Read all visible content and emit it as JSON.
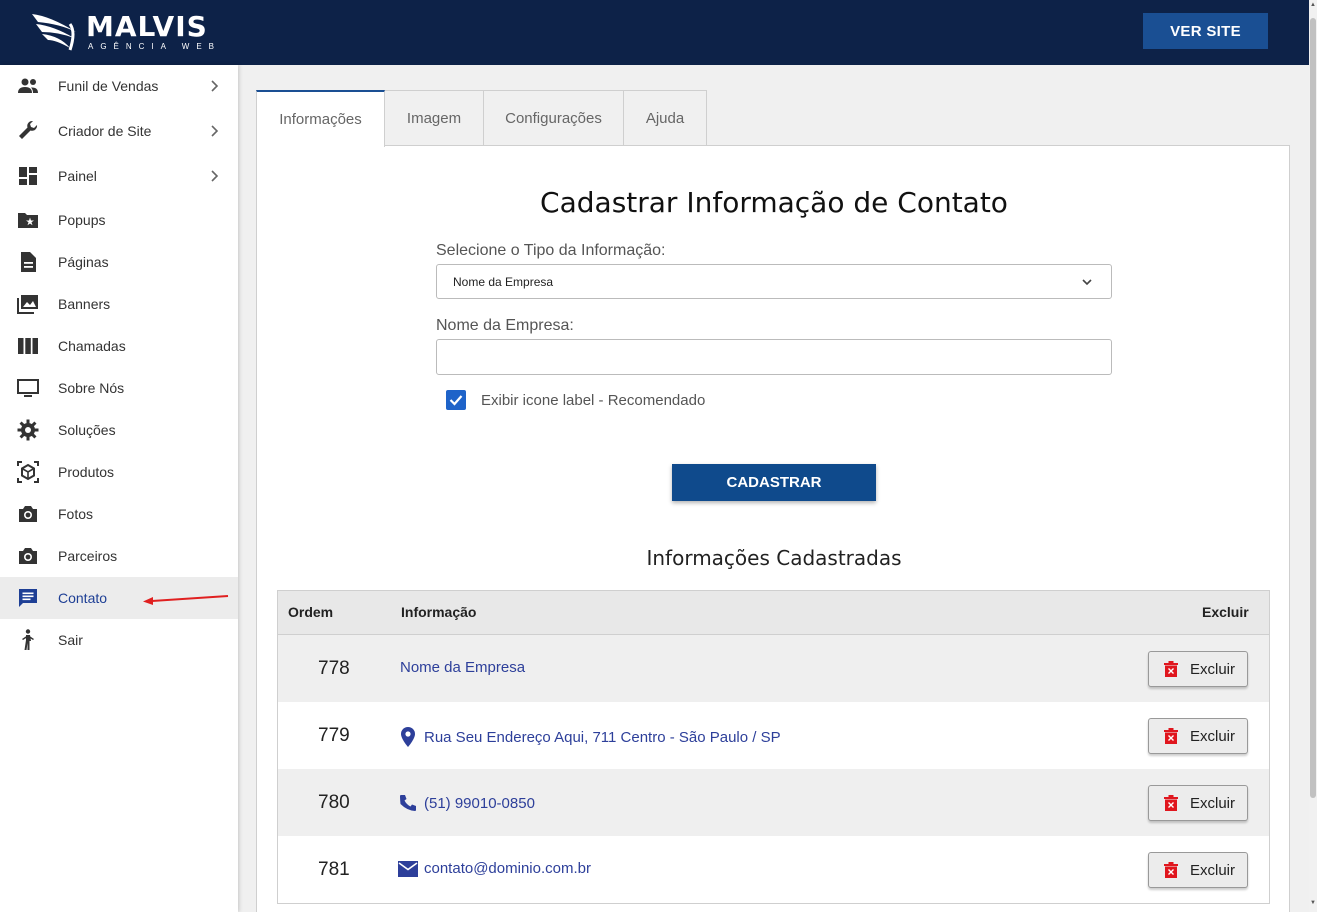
{
  "header": {
    "logo_title": "MALVIS",
    "logo_subtitle": "AGÊNCIA WEB",
    "ver_site_label": "VER SITE"
  },
  "sidebar": {
    "items": [
      {
        "label": "Funil de Vendas",
        "icon": "people-icon",
        "has_chevron": true
      },
      {
        "label": "Criador de Site",
        "icon": "wrench-icon",
        "has_chevron": true
      },
      {
        "label": "Painel",
        "icon": "dashboard-icon",
        "has_chevron": true
      },
      {
        "label": "Popups",
        "icon": "folder-star-icon"
      },
      {
        "label": "Páginas",
        "icon": "document-icon"
      },
      {
        "label": "Banners",
        "icon": "photo-library-icon"
      },
      {
        "label": "Chamadas",
        "icon": "columns-icon"
      },
      {
        "label": "Sobre Nós",
        "icon": "monitor-icon"
      },
      {
        "label": "Soluções",
        "icon": "gear-icon"
      },
      {
        "label": "Produtos",
        "icon": "box-icon"
      },
      {
        "label": "Fotos",
        "icon": "camera-icon"
      },
      {
        "label": "Parceiros",
        "icon": "camera-icon"
      },
      {
        "label": "Contato",
        "icon": "message-icon",
        "active": true
      },
      {
        "label": "Sair",
        "icon": "person-walk-icon"
      }
    ]
  },
  "tabs": [
    {
      "label": "Informações",
      "active": true
    },
    {
      "label": "Imagem"
    },
    {
      "label": "Configurações"
    },
    {
      "label": "Ajuda"
    }
  ],
  "form": {
    "title": "Cadastrar Informação de Contato",
    "type_label": "Selecione o Tipo da Informação:",
    "type_selected": "Nome da Empresa",
    "name_label": "Nome da Empresa:",
    "name_value": "",
    "checkbox_label": "Exibir icone label - Recomendado",
    "checkbox_checked": true,
    "submit_label": "CADASTRAR"
  },
  "list": {
    "title": "Informações Cadastradas",
    "headers": {
      "order": "Ordem",
      "info": "Informação",
      "delete": "Excluir"
    },
    "rows": [
      {
        "order": "778",
        "info": "Nome da Empresa",
        "icon": "",
        "delete_label": "Excluir"
      },
      {
        "order": "779",
        "info": "Rua Seu Endereço Aqui, 711 Centro - São Paulo / SP",
        "icon": "location-pin-icon",
        "delete_label": "Excluir"
      },
      {
        "order": "780",
        "info": "(51) 99010-0850",
        "icon": "phone-icon",
        "delete_label": "Excluir"
      },
      {
        "order": "781",
        "info": "contato@dominio.com.br",
        "icon": "email-icon",
        "delete_label": "Excluir"
      }
    ]
  },
  "colors": {
    "header_bg": "#0d2248",
    "primary_button": "#0f4a8c",
    "link_text": "#2d3f9a",
    "delete_icon": "#e0161e",
    "annotation_arrow": "#e02020"
  }
}
